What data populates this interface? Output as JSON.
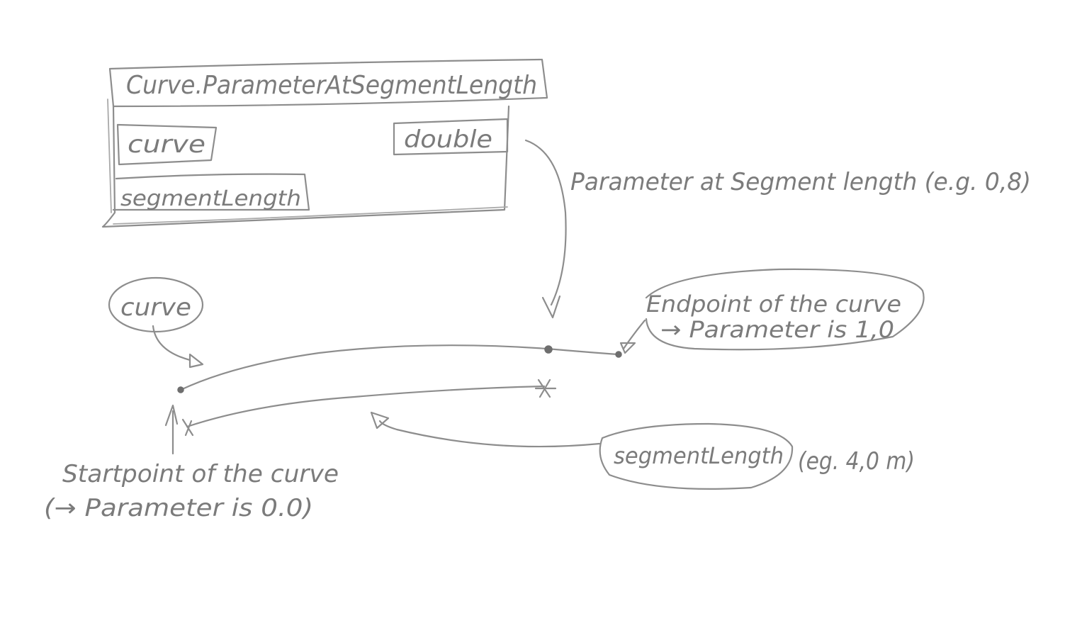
{
  "node": {
    "title": "Curve.ParameterAtSegmentLength",
    "inputs": [
      "curve",
      "segmentLength"
    ],
    "output": "double"
  },
  "annotations": {
    "output_note": "Parameter at Segment length (e.g. 0,8)",
    "curve_label": "curve",
    "endpoint_line1": "Endpoint of the curve",
    "endpoint_line2": "→ Parameter is 1,0",
    "startpoint_line1": "Startpoint of the curve",
    "startpoint_line2": "(→ Parameter is 0.0)",
    "segment_label": "segmentLength",
    "segment_example": "(eg. 4,0 m)"
  }
}
